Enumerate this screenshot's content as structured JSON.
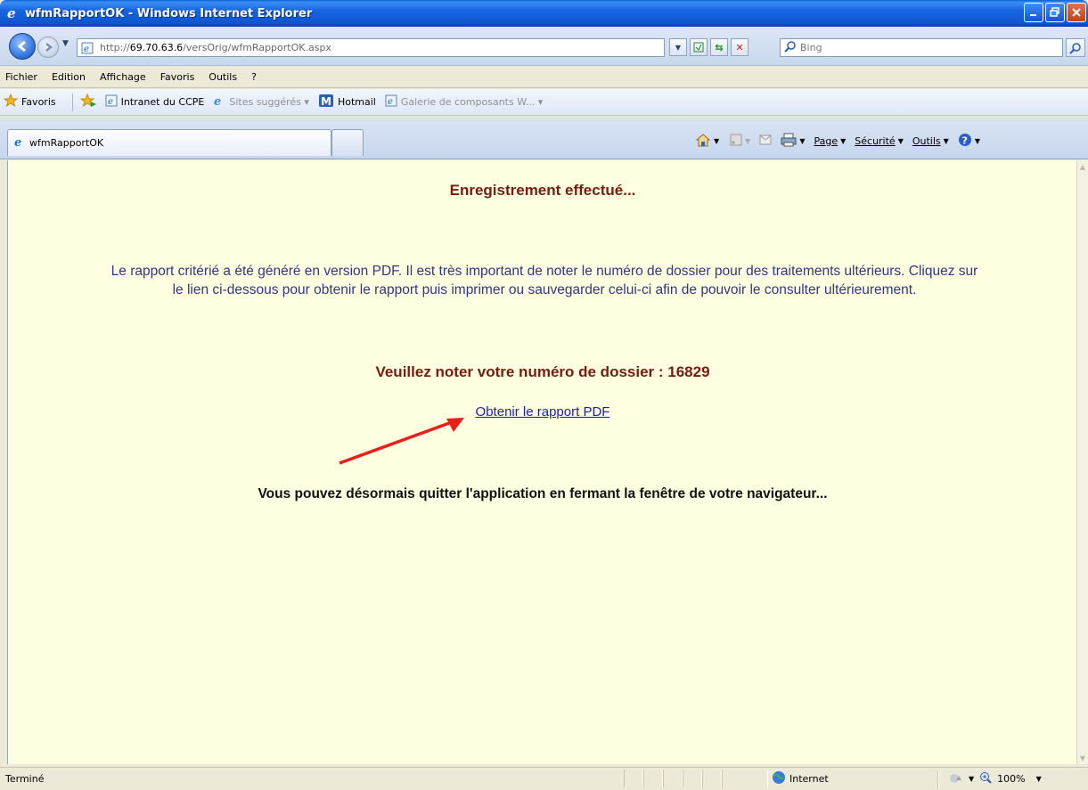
{
  "window": {
    "title": "wfmRapportOK - Windows Internet Explorer"
  },
  "address": {
    "url_prefix": "http://",
    "url_host": "69.70.63.6",
    "url_path": "/versOrig/wfmRapportOK.aspx",
    "search_placeholder": "Bing"
  },
  "menu": {
    "items": [
      "Fichier",
      "Edition",
      "Affichage",
      "Favoris",
      "Outils",
      "?"
    ]
  },
  "favorites": {
    "label": "Favoris",
    "items": [
      {
        "label": "Intranet du CCPE"
      },
      {
        "label": "Sites suggérés ▾"
      },
      {
        "label": "Hotmail"
      },
      {
        "label": "Galerie de composants W... ▾"
      }
    ]
  },
  "tabs": {
    "active_label": "wfmRapportOK"
  },
  "commands": {
    "page": "Page",
    "securite": "Sécurité",
    "outils": "Outils"
  },
  "content": {
    "heading": "Enregistrement effectué...",
    "message_line1": "Le rapport critérié a été généré en version PDF. Il est très important de noter le numéro de dossier pour des traitements ultérieurs. Cliquez sur",
    "message_line2": "le lien ci-dessous pour obtenir le rapport puis imprimer ou sauvegarder celui-ci afin de pouvoir le consulter ultérieurement.",
    "dossier_label": "Veuillez noter votre numéro de dossier : 16829",
    "pdf_link": "Obtenir le rapport PDF",
    "quit_message": "Vous pouvez désormais quitter l'application en fermant la fenêtre de votre navigateur..."
  },
  "status": {
    "text": "Terminé",
    "zone": "Internet",
    "zoom": "100%"
  },
  "colors": {
    "content_bg": "#ffffe1",
    "heading": "#7a1a10",
    "message": "#33348a",
    "link": "#1a1acc",
    "arrow": "#e8201a"
  }
}
